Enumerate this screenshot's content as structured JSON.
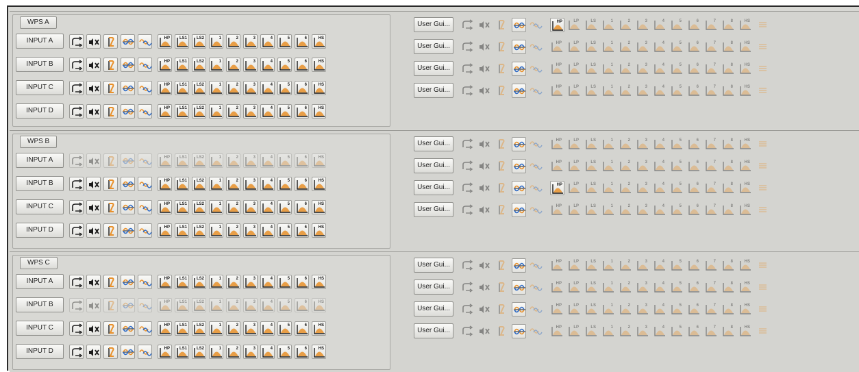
{
  "colors": {
    "orange": "#e8902a",
    "blue": "#2e6ac4",
    "dark": "#1a1a1a",
    "panel": "#d8d8d4"
  },
  "left_icons": [
    "route-icon",
    "mute-icon",
    "polarity-icon",
    "phase-icon",
    "delay-icon",
    "hp-filter-icon",
    "ls1-shelf-icon",
    "ls2-shelf-icon",
    "eq-band-1-icon",
    "eq-band-2-icon",
    "eq-band-3-icon",
    "eq-band-4-icon",
    "eq-band-5-icon",
    "eq-band-6-icon",
    "hs-shelf-icon"
  ],
  "left_labels": [
    "",
    "",
    "",
    "",
    "",
    "HP",
    "LS1",
    "LS2",
    "1",
    "2",
    "3",
    "4",
    "5",
    "6",
    "HS"
  ],
  "right_labels": [
    "",
    "",
    "",
    "",
    "",
    "HP",
    "LP",
    "LS",
    "1",
    "2",
    "3",
    "4",
    "5",
    "6",
    "7",
    "8",
    "HS",
    ""
  ],
  "sections": [
    {
      "title": "WPS A",
      "inputs": [
        {
          "label": "INPUT A",
          "active": true
        },
        {
          "label": "INPUT B",
          "active": true
        },
        {
          "label": "INPUT C",
          "active": true
        },
        {
          "label": "INPUT D",
          "active": true
        }
      ],
      "user_rows": [
        {
          "label": "User Gui...",
          "hp_active": true
        },
        {
          "label": "User Gui...",
          "hp_active": false
        },
        {
          "label": "User Gui...",
          "hp_active": false
        },
        {
          "label": "User Gui...",
          "hp_active": false
        }
      ]
    },
    {
      "title": "WPS B",
      "inputs": [
        {
          "label": "INPUT A",
          "active": false
        },
        {
          "label": "INPUT B",
          "active": true
        },
        {
          "label": "INPUT C",
          "active": true
        },
        {
          "label": "INPUT D",
          "active": true
        }
      ],
      "user_rows": [
        {
          "label": "User Gui...",
          "hp_active": false
        },
        {
          "label": "User Gui...",
          "hp_active": false
        },
        {
          "label": "User Gui...",
          "hp_active": true
        },
        {
          "label": "User Gui...",
          "hp_active": false
        }
      ]
    },
    {
      "title": "WPS C",
      "inputs": [
        {
          "label": "INPUT A",
          "active": true
        },
        {
          "label": "INPUT B",
          "active": false
        },
        {
          "label": "INPUT C",
          "active": true
        },
        {
          "label": "INPUT D",
          "active": true
        }
      ],
      "user_rows": [
        {
          "label": "User Gui...",
          "hp_active": false
        },
        {
          "label": "User Gui...",
          "hp_active": false
        },
        {
          "label": "User Gui...",
          "hp_active": false
        },
        {
          "label": "User Gui...",
          "hp_active": false
        }
      ]
    }
  ]
}
